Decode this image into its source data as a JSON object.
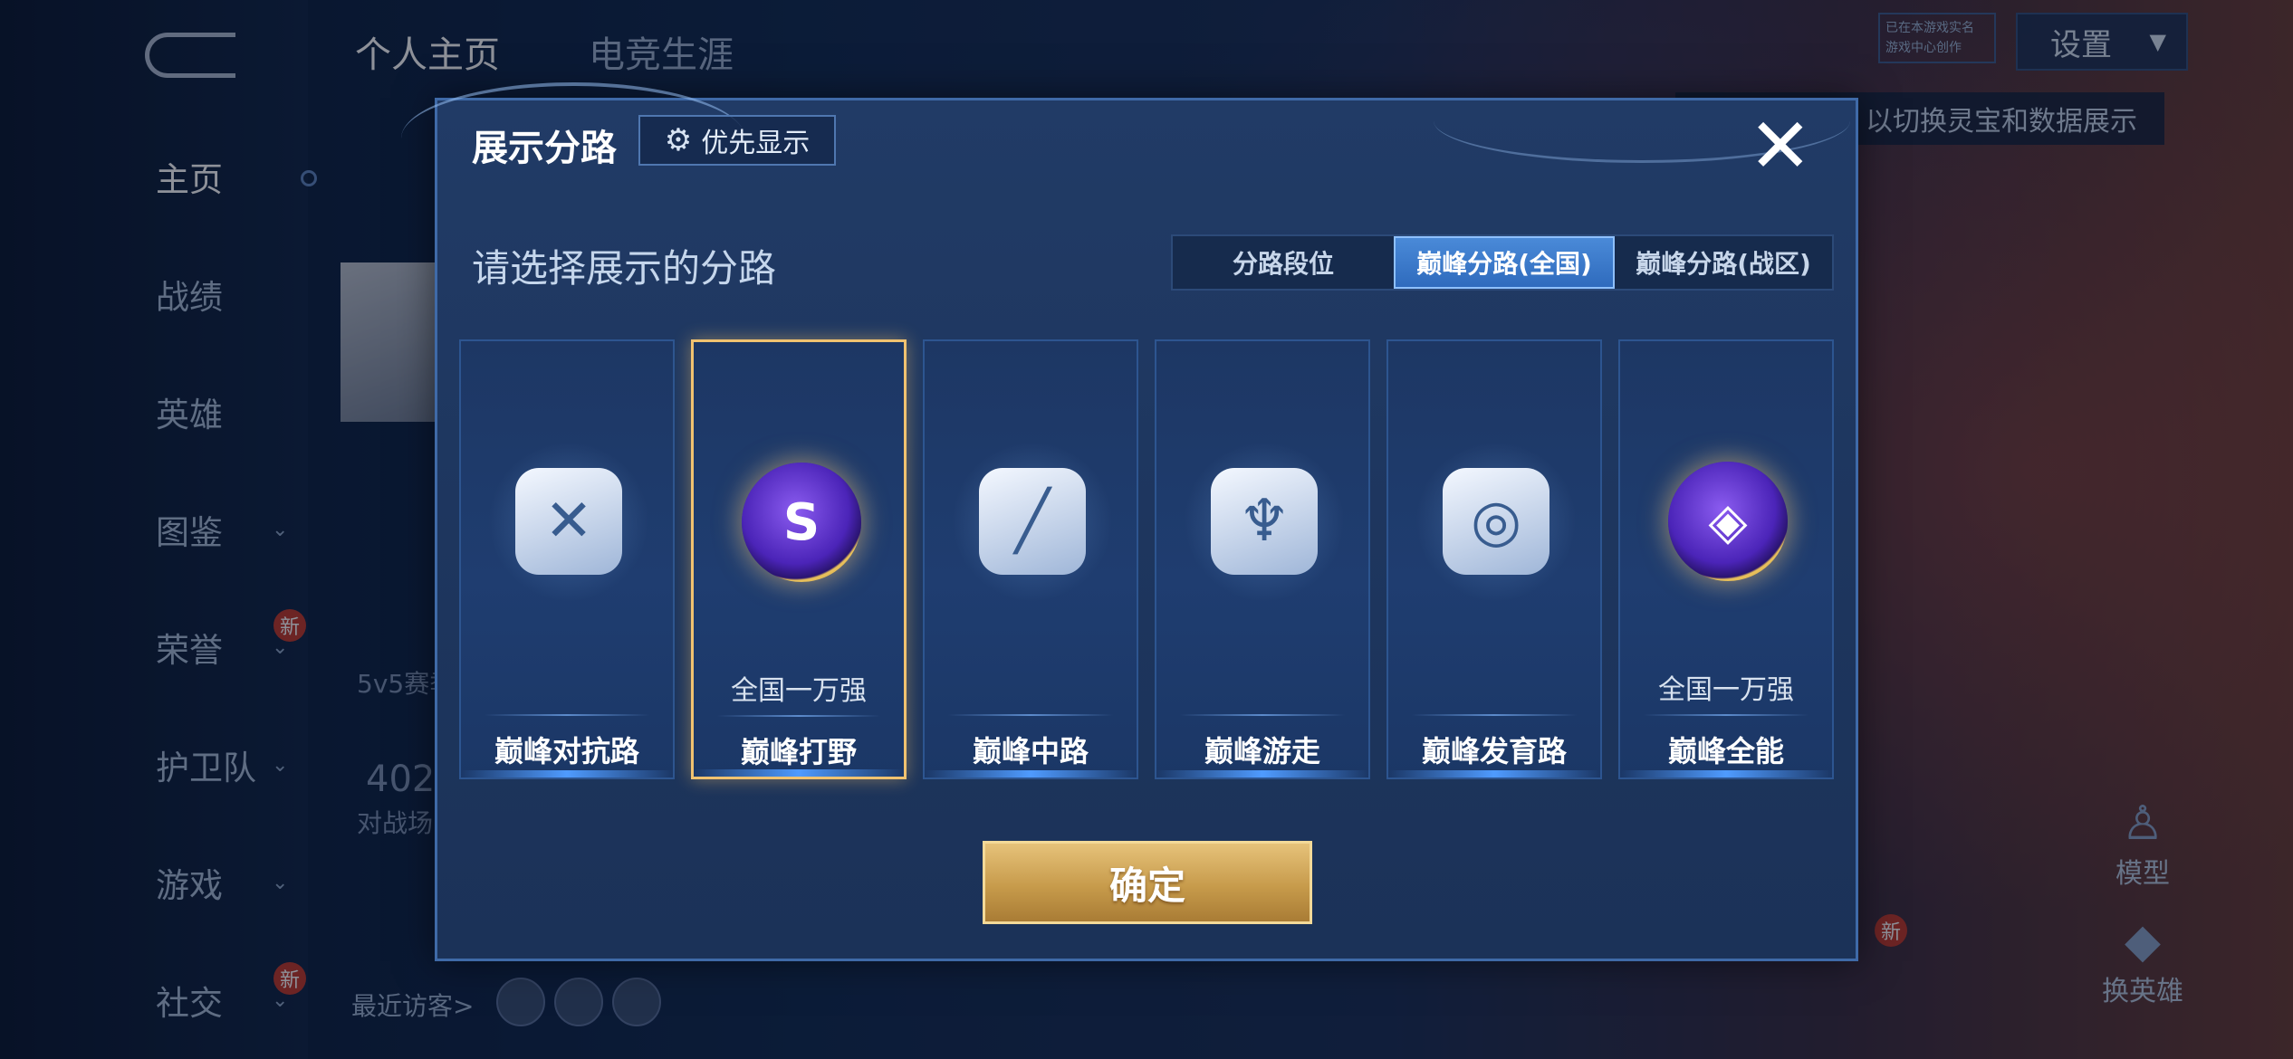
{
  "background": {
    "top_tabs": [
      {
        "label": "个人主页",
        "active": true
      },
      {
        "label": "电竞生涯",
        "active": false
      }
    ],
    "sidebar": [
      {
        "label": "主页",
        "active": true,
        "chevron": false,
        "badge": ""
      },
      {
        "label": "战绩",
        "active": false,
        "chevron": false,
        "badge": ""
      },
      {
        "label": "英雄",
        "active": false,
        "chevron": false,
        "badge": ""
      },
      {
        "label": "图鉴",
        "active": false,
        "chevron": true,
        "badge": ""
      },
      {
        "label": "荣誉",
        "active": false,
        "chevron": true,
        "badge": "新"
      },
      {
        "label": "护卫队",
        "active": false,
        "chevron": true,
        "badge": ""
      },
      {
        "label": "游戏",
        "active": false,
        "chevron": true,
        "badge": ""
      },
      {
        "label": "社交",
        "active": false,
        "chevron": true,
        "badge": "新"
      }
    ],
    "settings_label": "设置",
    "small_badge_lines": [
      "已在本游戏实名",
      "游戏中心创作"
    ],
    "hint_text": "以切换灵宝和数据展示",
    "left_partial_texts": {
      "season": "5v5赛季",
      "count": "402",
      "count_label": "对战场"
    },
    "recent_visitors_label": "最近访客>",
    "side_actions": [
      {
        "label": "模型",
        "badge": ""
      },
      {
        "label": "换英雄",
        "badge": "新"
      }
    ],
    "colors": {
      "accent_gold": "#f0c270",
      "accent_blue": "#4a8ad8",
      "modal_bg": "#1d355d"
    }
  },
  "modal": {
    "title": "展示分路",
    "priority_button": {
      "icon": "gear-icon",
      "label": "优先显示"
    },
    "close_icon": "close-icon",
    "subtitle": "请选择展示的分路",
    "tabs": [
      {
        "label": "分路段位",
        "selected": false
      },
      {
        "label": "巅峰分路(全国)",
        "selected": true
      },
      {
        "label": "巅峰分路(战区)",
        "selected": false
      }
    ],
    "cards": [
      {
        "label": "巅峰对抗路",
        "rank": "",
        "emblem": "clash-lane-icon",
        "glyph": "✕",
        "style": "plain",
        "selected": false
      },
      {
        "label": "巅峰打野",
        "rank": "全国一万强",
        "emblem": "jungle-emblem-icon",
        "glyph": "S",
        "style": "gold",
        "selected": true
      },
      {
        "label": "巅峰中路",
        "rank": "",
        "emblem": "mid-lane-icon",
        "glyph": "╱",
        "style": "plain",
        "selected": false
      },
      {
        "label": "巅峰游走",
        "rank": "",
        "emblem": "roam-icon",
        "glyph": "♆",
        "style": "plain",
        "selected": false
      },
      {
        "label": "巅峰发育路",
        "rank": "",
        "emblem": "farm-lane-icon",
        "glyph": "◎",
        "style": "plain",
        "selected": false
      },
      {
        "label": "巅峰全能",
        "rank": "全国一万强",
        "emblem": "all-round-emblem-icon",
        "glyph": "◈",
        "style": "gold",
        "selected": false
      }
    ],
    "confirm_label": "确定"
  }
}
